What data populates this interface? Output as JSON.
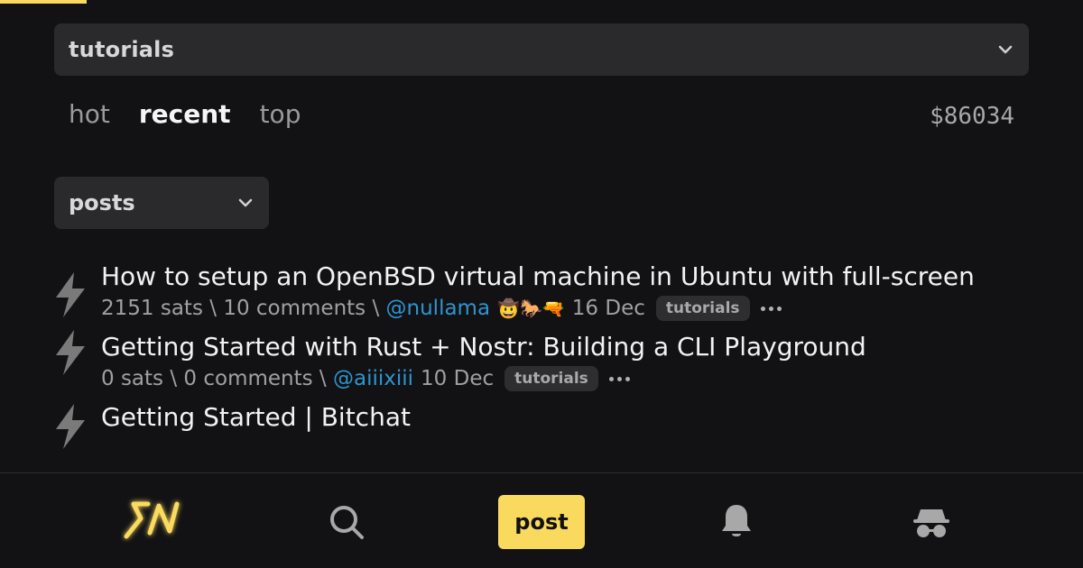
{
  "header": {
    "territory_label": "tutorials",
    "sort_tabs": [
      "hot",
      "recent",
      "top"
    ],
    "active_sort": "recent",
    "btc_price": "$86034",
    "type_label": "posts"
  },
  "feed": [
    {
      "title": "How to setup an OpenBSD virtual machine in Ubuntu with full-screen",
      "sats": "2151 sats",
      "sep1": " \\ ",
      "comments": "10 comments",
      "sep2": " \\ ",
      "user": "@nullama",
      "hats": "🤠🐎🔫",
      "date": "16 Dec",
      "tag": "tutorials"
    },
    {
      "title": "Getting Started with Rust + Nostr: Building a CLI Playground",
      "sats": "0 sats",
      "sep1": " \\ ",
      "comments": "0 comments",
      "sep2": " \\ ",
      "user": "@aiiixiii",
      "date": "10 Dec",
      "tag": "tutorials"
    },
    {
      "title": "Getting Started | Bitchat"
    }
  ],
  "bottom_nav": {
    "post_label": "post"
  },
  "colors": {
    "accent": "#fada5e",
    "link": "#2e95d0",
    "background": "#121214"
  }
}
